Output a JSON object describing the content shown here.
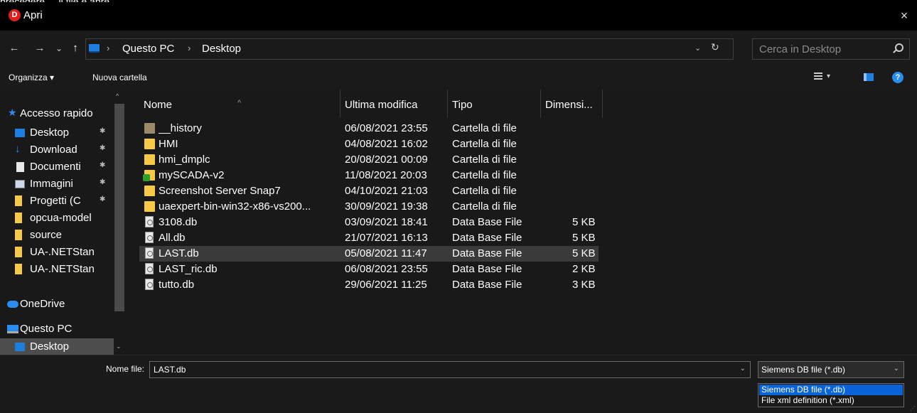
{
  "background_text": "precedere ... il file e apre",
  "window": {
    "title": "Apri",
    "app_icon": "D",
    "close_label": "×"
  },
  "nav": {
    "back": "←",
    "forward": "→",
    "recent": "⌄",
    "up": "↑",
    "breadcrumb": [
      "Questo PC",
      "Desktop"
    ],
    "separator": "›",
    "dropdown": "⌄",
    "refresh": "↻",
    "search_placeholder": "Cerca in Desktop"
  },
  "toolbar": {
    "organize": "Organizza ▾",
    "new_folder": "Nuova cartella",
    "view_dd": "▾",
    "help": "?"
  },
  "sidebar": {
    "items": [
      {
        "label": "Accesso rapido",
        "icon": "star-icon",
        "pinned": false
      },
      {
        "label": "Desktop",
        "icon": "desktop-icon",
        "pinned": true
      },
      {
        "label": "Download",
        "icon": "download-icon",
        "pinned": true
      },
      {
        "label": "Documenti",
        "icon": "document-icon",
        "pinned": true
      },
      {
        "label": "Immagini",
        "icon": "image-icon",
        "pinned": true
      },
      {
        "label": "Progetti (C",
        "icon": "folder-icon",
        "pinned": true
      },
      {
        "label": "opcua-model",
        "icon": "folder-icon",
        "pinned": false
      },
      {
        "label": "source",
        "icon": "folder-icon",
        "pinned": false
      },
      {
        "label": "UA-.NETStan",
        "icon": "folder-icon",
        "pinned": false
      },
      {
        "label": "UA-.NETStan",
        "icon": "folder-icon",
        "pinned": false
      },
      {
        "label": "OneDrive",
        "icon": "cloud-icon",
        "pinned": false
      },
      {
        "label": "Questo PC",
        "icon": "computer-icon",
        "pinned": false
      },
      {
        "label": "Desktop",
        "icon": "desktop-icon",
        "pinned": false
      }
    ],
    "pin_glyph": "✱",
    "scroll_up": "^",
    "scroll_down": "⌄"
  },
  "columns": {
    "name": "Nome",
    "modified": "Ultima modifica",
    "type": "Tipo",
    "size": "Dimensi...",
    "sort_glyph": "^"
  },
  "files": [
    {
      "name": "__history",
      "modified": "06/08/2021 23:55",
      "type": "Cartella di file",
      "size": "",
      "kind": "folder-history"
    },
    {
      "name": "HMI",
      "modified": "04/08/2021 16:02",
      "type": "Cartella di file",
      "size": "",
      "kind": "folder"
    },
    {
      "name": "hmi_dmplc",
      "modified": "20/08/2021 00:09",
      "type": "Cartella di file",
      "size": "",
      "kind": "folder"
    },
    {
      "name": "mySCADA-v2",
      "modified": "11/08/2021 20:03",
      "type": "Cartella di file",
      "size": "",
      "kind": "folder-synced"
    },
    {
      "name": "Screenshot Server Snap7",
      "modified": "04/10/2021 21:03",
      "type": "Cartella di file",
      "size": "",
      "kind": "folder"
    },
    {
      "name": "uaexpert-bin-win32-x86-vs200...",
      "modified": "30/09/2021 19:38",
      "type": "Cartella di file",
      "size": "",
      "kind": "folder"
    },
    {
      "name": "3108.db",
      "modified": "03/09/2021 18:41",
      "type": "Data Base File",
      "size": "5 KB",
      "kind": "file"
    },
    {
      "name": "All.db",
      "modified": "21/07/2021 16:13",
      "type": "Data Base File",
      "size": "5 KB",
      "kind": "file"
    },
    {
      "name": "LAST.db",
      "modified": "05/08/2021 11:47",
      "type": "Data Base File",
      "size": "5 KB",
      "kind": "file",
      "selected": true
    },
    {
      "name": "LAST_ric.db",
      "modified": "06/08/2021 23:55",
      "type": "Data Base File",
      "size": "2 KB",
      "kind": "file"
    },
    {
      "name": "tutto.db",
      "modified": "29/06/2021 11:25",
      "type": "Data Base File",
      "size": "3 KB",
      "kind": "file"
    }
  ],
  "footer": {
    "filename_label": "Nome file:",
    "filename_value": "LAST.db",
    "dd_glyph": "⌄",
    "filetype_selected": "Siemens DB file (*.db)",
    "filetype_options": [
      "Siemens DB file (*.db)",
      "File xml definition (*.xml)"
    ],
    "grip": "⋰"
  },
  "colors": {
    "selection_blue": "#0a64d8",
    "row_selected": "#3a3a3a",
    "folder": "#f7c948"
  }
}
